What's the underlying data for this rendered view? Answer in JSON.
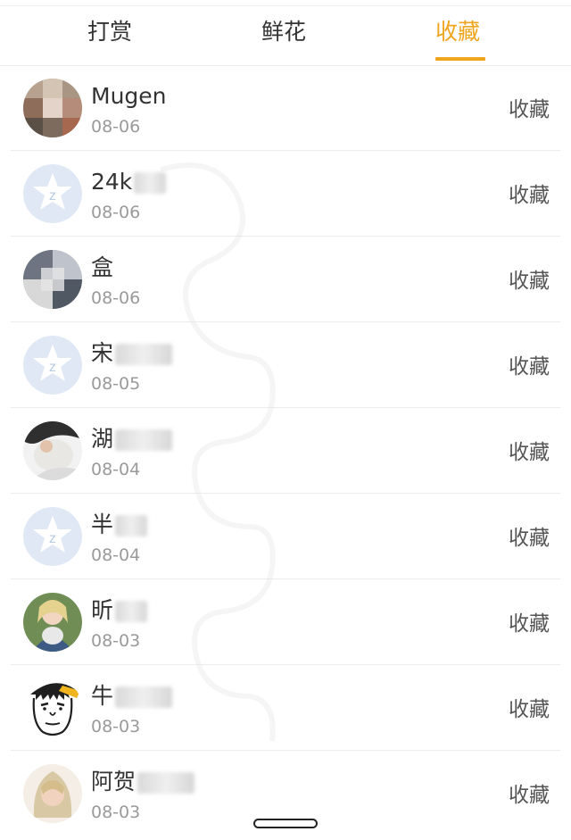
{
  "tabs": [
    {
      "label": "打赏",
      "active": false
    },
    {
      "label": "鲜花",
      "active": false
    },
    {
      "label": "收藏",
      "active": true
    }
  ],
  "colors": {
    "accent": "#f0a51f",
    "text": "#333333",
    "subtext": "#9a9a9a",
    "divider": "#ececec"
  },
  "list": [
    {
      "name": "Mugen",
      "date": "08-06",
      "action": "收藏",
      "avatar_icon": "pixelated-photo-avatar"
    },
    {
      "name": "24k",
      "date": "08-06",
      "action": "收藏",
      "avatar_icon": "default-star-avatar"
    },
    {
      "name": "盒",
      "date": "08-06",
      "action": "收藏",
      "avatar_icon": "pixelated-photo-avatar"
    },
    {
      "name": "宋",
      "date": "08-05",
      "action": "收藏",
      "avatar_icon": "default-star-avatar"
    },
    {
      "name": "湖",
      "date": "08-04",
      "action": "收藏",
      "avatar_icon": "photo-avatar"
    },
    {
      "name": "半",
      "date": "08-04",
      "action": "收藏",
      "avatar_icon": "default-star-avatar"
    },
    {
      "name": "昕",
      "date": "08-03",
      "action": "收藏",
      "avatar_icon": "photo-avatar"
    },
    {
      "name": "牛",
      "date": "08-03",
      "action": "收藏",
      "avatar_icon": "cartoon-face-avatar"
    },
    {
      "name": "阿贺",
      "date": "08-03",
      "action": "收藏",
      "avatar_icon": "photo-avatar"
    }
  ]
}
